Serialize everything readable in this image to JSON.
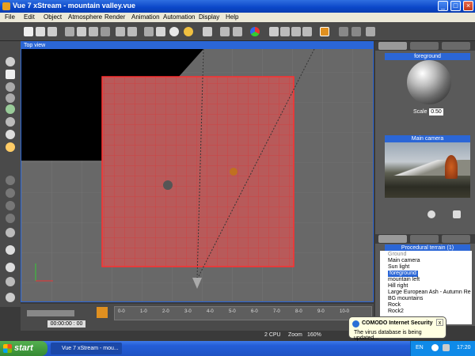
{
  "window": {
    "title": "Vue 7 xStream - mountain valley.vue",
    "min": "_",
    "max": "□",
    "close": "×"
  },
  "menu": [
    "File",
    "Edit",
    "Object",
    "Atmosphere",
    "Render",
    "Animation",
    "Automation",
    "Display",
    "Help"
  ],
  "viewport": {
    "title": "Top view"
  },
  "material": {
    "name": "foreground",
    "scale_label": "Scale",
    "scale_value": "0.50"
  },
  "camera": {
    "name": "Main camera"
  },
  "scene": {
    "header": "Procedural terrain (1)",
    "items": [
      {
        "label": "Ground",
        "style": "grey"
      },
      {
        "label": "Main camera",
        "style": "normal"
      },
      {
        "label": "Sun light",
        "style": "normal"
      },
      {
        "label": "foreground",
        "style": "sel"
      },
      {
        "label": "mountain left",
        "style": "normal"
      },
      {
        "label": "Hill right",
        "style": "normal"
      },
      {
        "label": "Large European Ash - Autumn Re",
        "style": "normal"
      },
      {
        "label": "BG mountains",
        "style": "normal"
      },
      {
        "label": "Rock",
        "style": "normal"
      },
      {
        "label": "Rock2",
        "style": "normal"
      }
    ]
  },
  "timeline": {
    "time": "00:00:00 : 00",
    "ticks": [
      "0-0",
      "1-0",
      "2-0",
      "3-0",
      "4-0",
      "5-0",
      "6-0",
      "7-0",
      "8-0",
      "9-0",
      "10-0"
    ]
  },
  "status": {
    "cpu": "2 CPU",
    "zoom_label": "Zoom",
    "zoom": "160%"
  },
  "taskbar": {
    "start": "start",
    "task": "Vue 7 xStream - mou...",
    "lang": "EN",
    "clock": "17:20"
  },
  "balloon": {
    "title": "COMODO Internet Security",
    "body": "The virus database is being updated...",
    "close": "x"
  },
  "colors": {
    "terrain": "#b85a5a",
    "grid": "#e03030",
    "selection": "#2b66d6"
  }
}
